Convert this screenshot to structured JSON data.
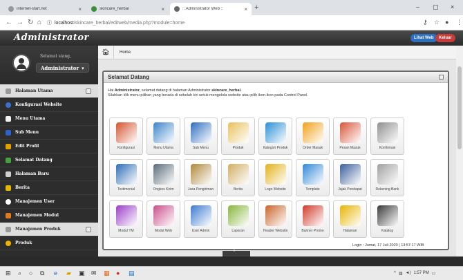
{
  "browser": {
    "tabs": [
      {
        "title": "internet-start.net",
        "active": false
      },
      {
        "title": "skincare_herbal",
        "active": false
      },
      {
        "title": ":: Administrator Web ::",
        "active": true
      }
    ],
    "new_tab": "+",
    "url_host": "localhost",
    "url_path": "/skincare_herbal/editweb/media.php?module=home",
    "win": {
      "min": "–",
      "max": "▢",
      "close": "×"
    }
  },
  "header": {
    "brand": "Administrator",
    "lihat_web": "Lihat Web",
    "keluar": "Keluar"
  },
  "sidebar": {
    "welcome": "Selamat siang,",
    "username": "Administrator",
    "sections": [
      {
        "label": "Halaman Utama",
        "type": "section"
      },
      {
        "label": "Konfigurasi Website",
        "color": "#3b6fd1"
      },
      {
        "label": "Menu Utama",
        "color": "#f2f2f2"
      },
      {
        "label": "Sub Menu",
        "color": "#2e62c9"
      },
      {
        "label": "Edit Profil",
        "color": "#e0a100"
      },
      {
        "label": "Selamat Datang",
        "color": "#45a142"
      },
      {
        "label": "Halaman Baru",
        "color": "#d0d0d0"
      },
      {
        "label": "Berita",
        "color": "#e3b600"
      },
      {
        "label": "Manajemen User",
        "color": "#ffffff"
      },
      {
        "label": "Manajemen Modul",
        "color": "#e07a1e"
      },
      {
        "label": "Manajemen Produk",
        "type": "section"
      },
      {
        "label": "Produk",
        "color": "#f0b400"
      }
    ]
  },
  "main": {
    "breadcrumb": "Home",
    "panel_title": "Selamat Datang",
    "intro_hai": "Hai ",
    "intro_admin": "Administrator",
    "intro_mid": ", selamat datang di halaman Administrator ",
    "intro_site": "skincare_herbal.",
    "intro_line2": "Silahkan klik menu pilihan yang berada di sebelah kiri untuk mengelola website atau pilih ikon-ikon pada Control Panel.",
    "tiles": [
      {
        "label": "Konfigurasi",
        "color": "#d4542e"
      },
      {
        "label": "Menu Utama",
        "color": "#3a84c9"
      },
      {
        "label": "Sub Menu",
        "color": "#2f6fc0"
      },
      {
        "label": "Produk",
        "color": "#e8c15a"
      },
      {
        "label": "Kategori Produk",
        "color": "#2a8fd6"
      },
      {
        "label": "Order Masuk",
        "color": "#f0a21a"
      },
      {
        "label": "Pesan Masuk",
        "color": "#d9563a"
      },
      {
        "label": "Konfirmasi",
        "color": "#8f8f8f"
      },
      {
        "label": "Testimonial",
        "color": "#2d6db5"
      },
      {
        "label": "Ongkos Kirim",
        "color": "#5a6b7a"
      },
      {
        "label": "Jasa Pengiriman",
        "color": "#b0883a"
      },
      {
        "label": "Berita",
        "color": "#d1ad62"
      },
      {
        "label": "Logo Website",
        "color": "#e3b11a"
      },
      {
        "label": "Template",
        "color": "#2f87d6"
      },
      {
        "label": "Jajak Pendapat",
        "color": "#3b5e9c"
      },
      {
        "label": "Rekening Bank",
        "color": "#a0a0a0"
      },
      {
        "label": "Modul YM",
        "color": "#9a3fc7"
      },
      {
        "label": "Modul Web",
        "color": "#c94f8c"
      },
      {
        "label": "User Admin",
        "color": "#3d7bd1"
      },
      {
        "label": "Laporan",
        "color": "#86b63b"
      },
      {
        "label": "Header Website",
        "color": "#c9642a"
      },
      {
        "label": "Banner Promo",
        "color": "#cf3a2a"
      },
      {
        "label": "Halaman",
        "color": "#e8b400"
      },
      {
        "label": "Katalog",
        "color": "#3a3a3a"
      }
    ],
    "login_info": "Login : Jumat, 17 Juli 2020 | 13:57:17 WIB"
  },
  "taskbar": {
    "time": "1:57 PM"
  }
}
